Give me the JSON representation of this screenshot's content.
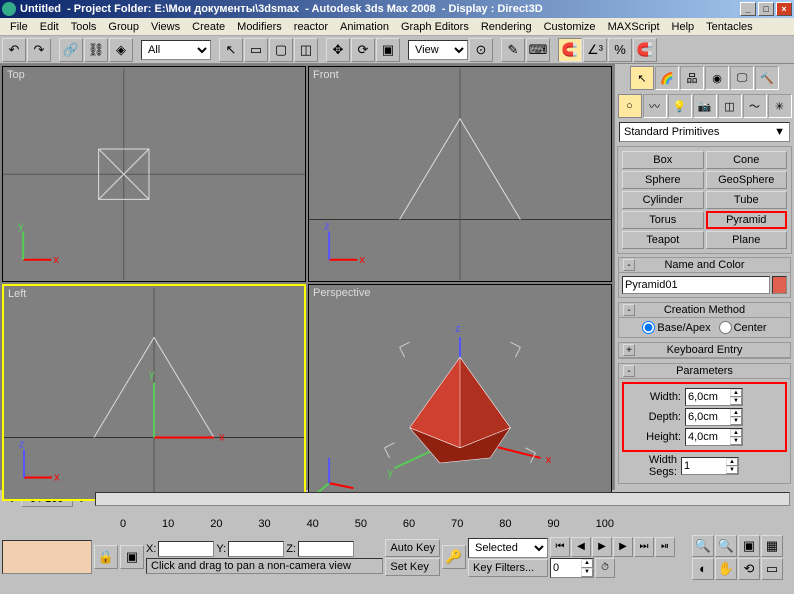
{
  "title": {
    "untitled": "Untitled",
    "project": "- Project Folder: E:\\Мои документы\\3dsmax",
    "app": "- Autodesk 3ds Max 2008",
    "display": "- Display : Direct3D"
  },
  "menu": [
    "File",
    "Edit",
    "Tools",
    "Group",
    "Views",
    "Create",
    "Modifiers",
    "reactor",
    "Animation",
    "Graph Editors",
    "Rendering",
    "Customize",
    "MAXScript",
    "Help",
    "Tentacles"
  ],
  "toolbar": {
    "sel_filter": "All",
    "refcoord": "View"
  },
  "viewports": {
    "top": "Top",
    "front": "Front",
    "left": "Left",
    "perspective": "Perspective"
  },
  "panel": {
    "category": "Standard Primitives",
    "objects": [
      [
        "Box",
        "Cone"
      ],
      [
        "Sphere",
        "GeoSphere"
      ],
      [
        "Cylinder",
        "Tube"
      ],
      [
        "Torus",
        "Pyramid"
      ],
      [
        "Teapot",
        "Plane"
      ]
    ],
    "rollouts": {
      "nameColor": "Name and Color",
      "creation": "Creation Method",
      "keyboard": "Keyboard Entry",
      "params": "Parameters"
    },
    "objName": "Pyramid01",
    "swatch": "#e06050",
    "creation": {
      "base": "Base/Apex",
      "center": "Center"
    },
    "params": {
      "widthLabel": "Width:",
      "width": "6,0cm",
      "depthLabel": "Depth:",
      "depth": "6,0cm",
      "heightLabel": "Height:",
      "height": "4,0cm",
      "wsegsLabel": "Width Segs:",
      "wsegs": "1"
    }
  },
  "time": {
    "frame": "0 / 100",
    "ticks": [
      "0",
      "10",
      "20",
      "30",
      "40",
      "50",
      "60",
      "70",
      "80",
      "90",
      "100"
    ]
  },
  "status": {
    "x": "X:",
    "y": "Y:",
    "z": "Z:",
    "prompt": "Click and drag to pan a non-camera view",
    "autoKey": "Auto Key",
    "setKey": "Set Key",
    "selected": "Selected",
    "keyFilters": "Key Filters...",
    "curFrame": "0"
  }
}
